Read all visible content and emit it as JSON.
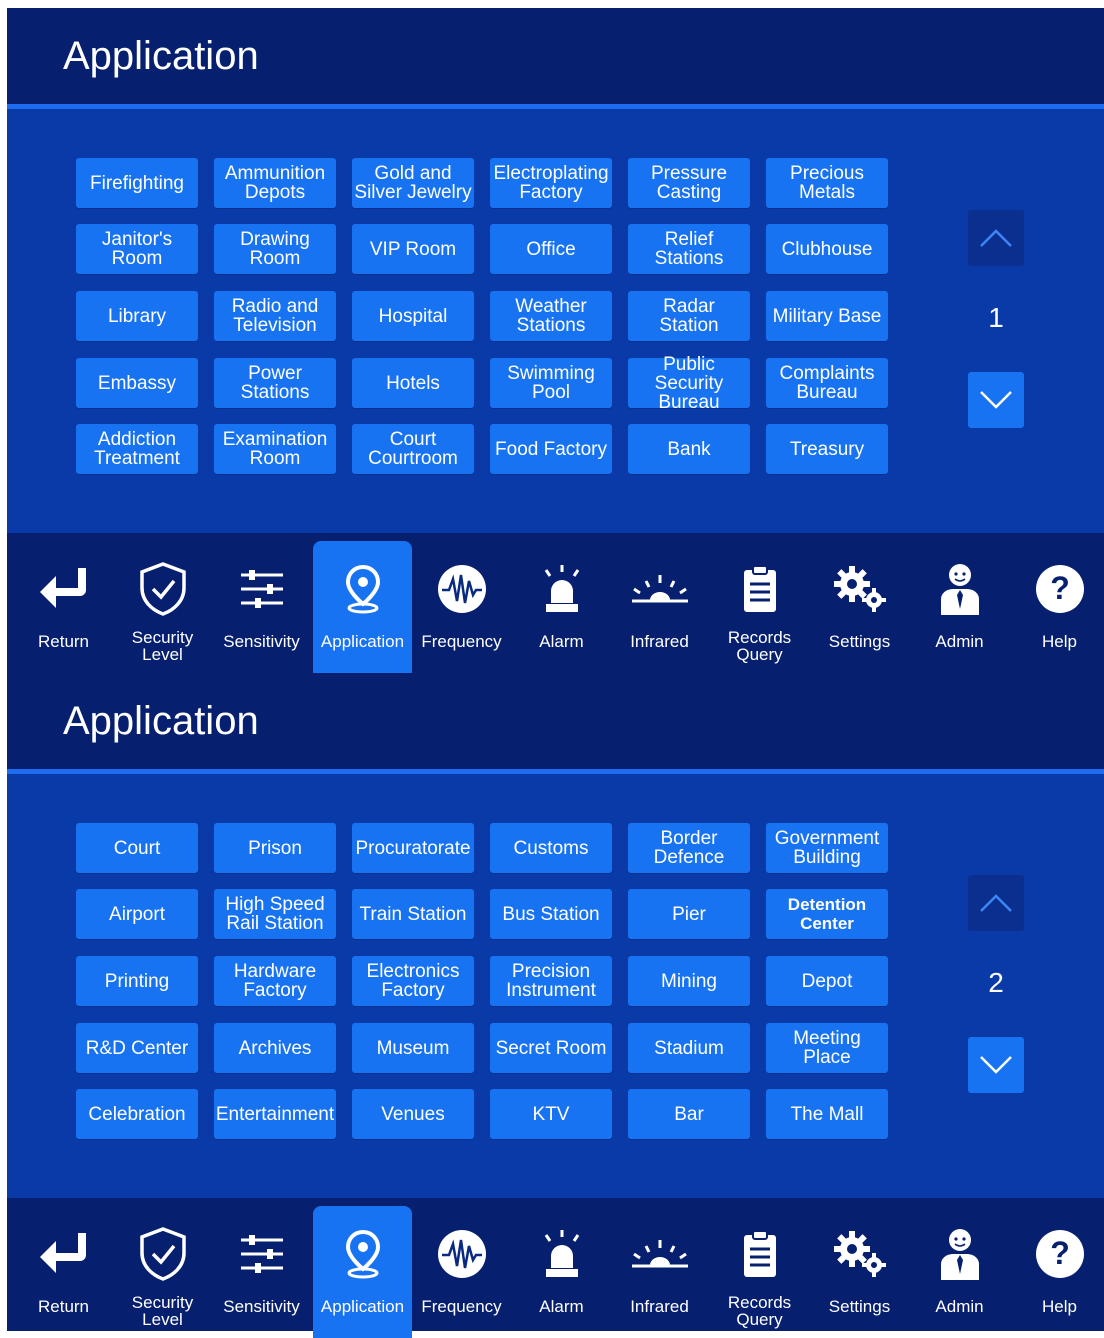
{
  "pages": [
    {
      "title": "Application",
      "page_number": "1",
      "apps": [
        "Firefighting",
        "Ammunition\nDepots",
        "Gold and\nSilver Jewelry",
        "Electroplating\nFactory",
        "Pressure\nCasting",
        "Precious\nMetals",
        "Janitor's\nRoom",
        "Drawing\nRoom",
        "VIP Room",
        "Office",
        "Relief\nStations",
        "Clubhouse",
        "Library",
        "Radio and\nTelevision",
        "Hospital",
        "Weather\nStations",
        "Radar\nStation",
        "Military Base",
        "Embassy",
        "Power\nStations",
        "Hotels",
        "Swimming\nPool",
        "Public Security\nBureau",
        "Complaints\nBureau",
        "Addiction\nTreatment",
        "Examination\nRoom",
        "Court\nCourtroom",
        "Food Factory",
        "Bank",
        "Treasury"
      ]
    },
    {
      "title": "Application",
      "page_number": "2",
      "apps": [
        "Court",
        "Prison",
        "Procuratorate",
        "Customs",
        "Border\nDefence",
        "Government\nBuilding",
        "Airport",
        "High Speed\nRail Station",
        "Train Station",
        "Bus Station",
        "Pier",
        "Detention\nCenter",
        "Printing",
        "Hardware\nFactory",
        "Electronics\nFactory",
        "Precision\nInstrument",
        "Mining",
        "Depot",
        "R&D Center",
        "Archives",
        "Museum",
        "Secret Room",
        "Stadium",
        "Meeting\nPlace",
        "Celebration",
        "Entertainment",
        "Venues",
        "KTV",
        "Bar",
        "The Mall"
      ]
    }
  ],
  "nav": [
    {
      "label": "Return",
      "icon": "return-icon"
    },
    {
      "label": "Security\nLevel",
      "icon": "shield-check-icon"
    },
    {
      "label": "Sensitivity",
      "icon": "sliders-icon"
    },
    {
      "label": "Application",
      "icon": "location-pin-icon",
      "active": true
    },
    {
      "label": "Frequency",
      "icon": "waveform-icon"
    },
    {
      "label": "Alarm",
      "icon": "alarm-siren-icon"
    },
    {
      "label": "Infrared",
      "icon": "infrared-icon"
    },
    {
      "label": "Records\nQuery",
      "icon": "clipboard-icon"
    },
    {
      "label": "Settings",
      "icon": "gears-icon"
    },
    {
      "label": "Admin",
      "icon": "admin-person-icon"
    },
    {
      "label": "Help",
      "icon": "question-icon"
    }
  ],
  "colors": {
    "panel": "#0a3aa8",
    "header": "#061f6e",
    "accent": "#1873f2",
    "text": "#ffffff"
  }
}
